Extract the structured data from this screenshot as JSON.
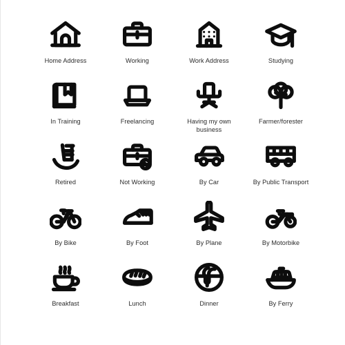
{
  "sheet": {
    "background_color": "#ffffff",
    "icon_color": "#0d0d0d",
    "label_color": "#2b2b2b",
    "columns": 4,
    "rows": 5
  },
  "icons": [
    {
      "label": "Home Address",
      "icon": "house-icon"
    },
    {
      "label": "Working",
      "icon": "briefcase-icon"
    },
    {
      "label": "Work Address",
      "icon": "office-building-icon"
    },
    {
      "label": "Studying",
      "icon": "graduation-cap-icon"
    },
    {
      "label": "In Training",
      "icon": "book-bookmark-icon"
    },
    {
      "label": "Freelancing",
      "icon": "laptop-icon"
    },
    {
      "label": "Having my own business",
      "icon": "office-chair-icon"
    },
    {
      "label": "Farmer/forester",
      "icon": "tree-icon"
    },
    {
      "label": "Retired",
      "icon": "rocking-chair-icon"
    },
    {
      "label": "Not Working",
      "icon": "briefcase-blocked-icon"
    },
    {
      "label": "By Car",
      "icon": "car-icon"
    },
    {
      "label": "By Public Transport",
      "icon": "bus-icon"
    },
    {
      "label": "By Bike",
      "icon": "bicycle-icon"
    },
    {
      "label": "By Foot",
      "icon": "sneaker-icon"
    },
    {
      "label": "By Plane",
      "icon": "airplane-icon"
    },
    {
      "label": "By Motorbike",
      "icon": "motorbike-icon"
    },
    {
      "label": "Breakfast",
      "icon": "coffee-cup-icon"
    },
    {
      "label": "Lunch",
      "icon": "sandwich-icon"
    },
    {
      "label": "Dinner",
      "icon": "pasta-bowl-icon"
    },
    {
      "label": "By Ferry",
      "icon": "ferry-boat-icon"
    }
  ]
}
